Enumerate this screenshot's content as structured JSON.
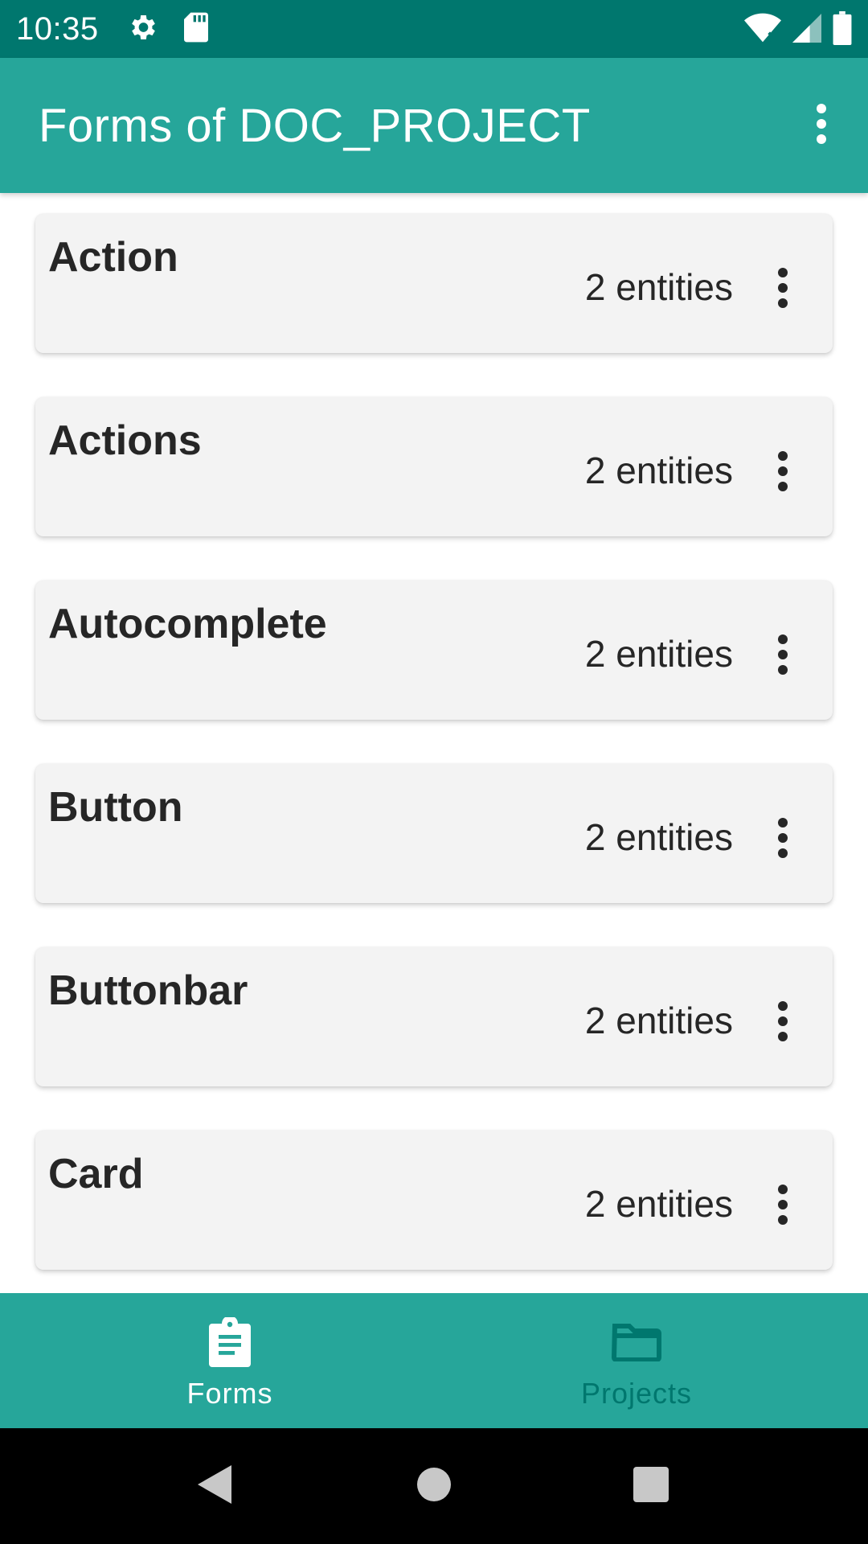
{
  "status_bar": {
    "time": "10:35",
    "icons": [
      "gear-icon",
      "sd-card-icon",
      "wifi-icon",
      "signal-icon",
      "battery-icon"
    ]
  },
  "app_bar": {
    "title": "Forms of DOC_PROJECT",
    "menu_icon": "more-vert-icon"
  },
  "forms": [
    {
      "name": "Action",
      "count": "2 entities"
    },
    {
      "name": "Actions",
      "count": "2 entities"
    },
    {
      "name": "Autocomplete",
      "count": "2 entities"
    },
    {
      "name": "Button",
      "count": "2 entities"
    },
    {
      "name": "Buttonbar",
      "count": "2 entities"
    },
    {
      "name": "Card",
      "count": "2 entities"
    }
  ],
  "bottom_nav": {
    "items": [
      {
        "label": "Forms",
        "icon": "clipboard-icon",
        "selected": true
      },
      {
        "label": "Projects",
        "icon": "folder-icon",
        "selected": false
      }
    ]
  },
  "colors": {
    "primary": "#26A69A",
    "primary_dark": "#00776E",
    "card_background": "#F3F3F3",
    "text": "#262626"
  }
}
